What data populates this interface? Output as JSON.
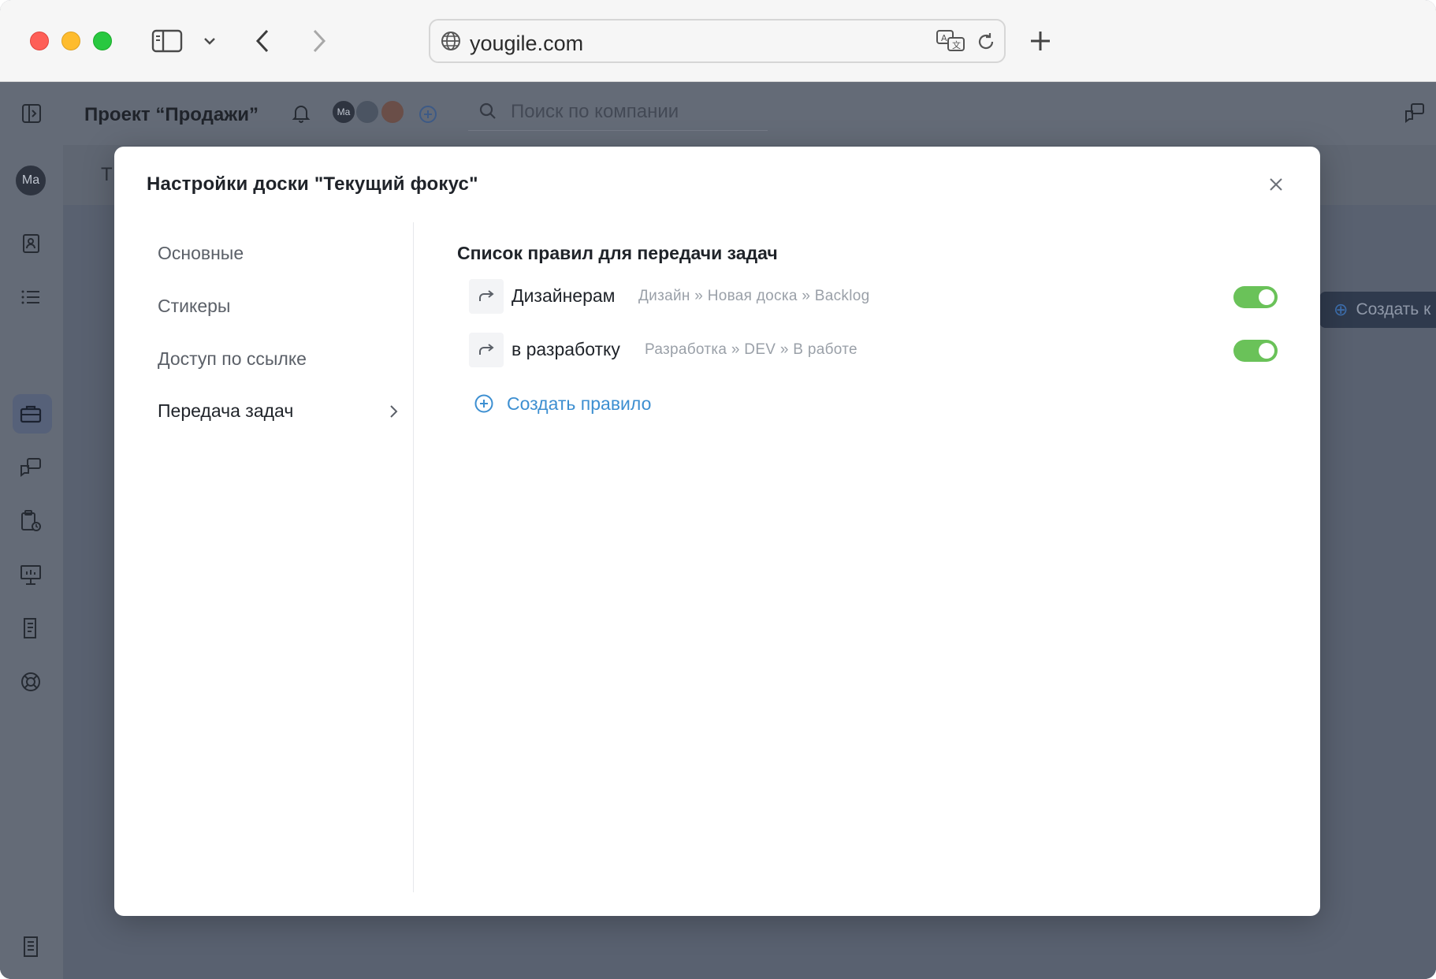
{
  "browser": {
    "url": "yougile.com"
  },
  "app": {
    "project_title": "Проект “Продажи”",
    "user_initials": "Ma",
    "search_placeholder": "Поиск по компании",
    "tab_partial": "Т",
    "create_button_partial": "Создать к"
  },
  "modal": {
    "title": "Настройки доски \"Текущий фокус\"",
    "nav": [
      {
        "label": "Основные",
        "active": false
      },
      {
        "label": "Стикеры",
        "active": false
      },
      {
        "label": "Доступ по ссылке",
        "active": false
      },
      {
        "label": "Передача задач",
        "active": true
      }
    ],
    "section_title": "Список правил для передачи задач",
    "rules": [
      {
        "name": "Дизайнерам",
        "path": "Дизайн » Новая доска » Backlog",
        "enabled": true
      },
      {
        "name": "в разработку",
        "path": "Разработка » DEV » В работе",
        "enabled": true
      }
    ],
    "create_rule_label": "Создать правило"
  },
  "colors": {
    "toggle_on": "#6ac259",
    "link_blue": "#3d8fd1",
    "overlay": "#5f6672"
  }
}
